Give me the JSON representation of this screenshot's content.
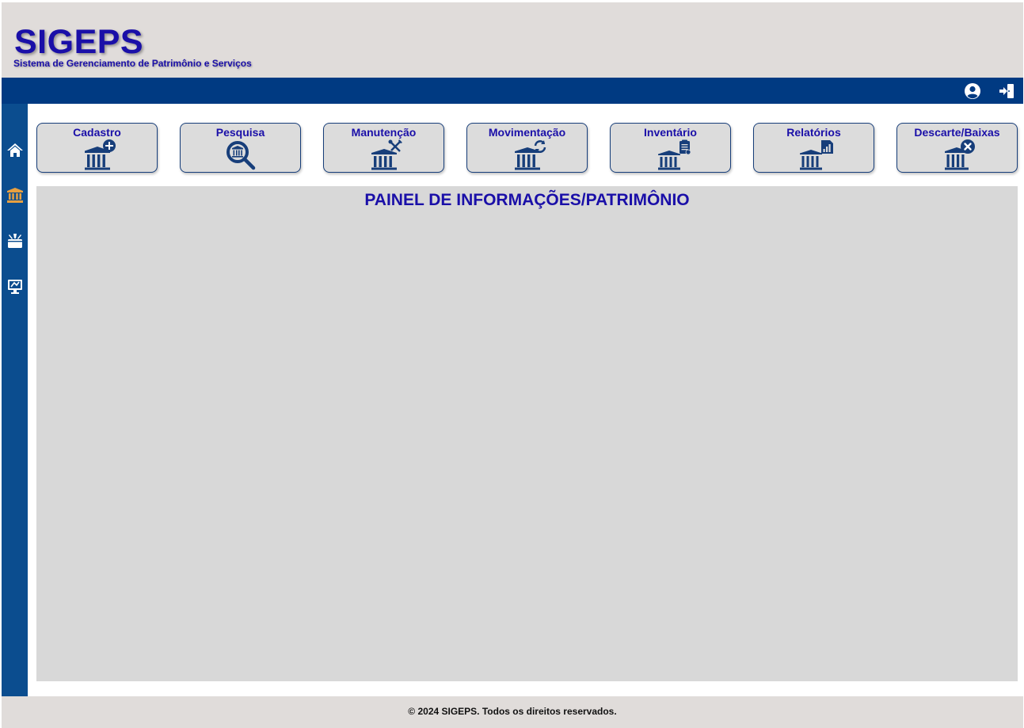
{
  "app": {
    "title": "SIGEPS",
    "subtitle": "Sistema de Gerenciamento de Patrimônio e Serviços"
  },
  "topbar": {
    "icons": [
      "user-circle-icon",
      "logout-icon"
    ]
  },
  "sidebar": {
    "items": [
      {
        "icon": "home-icon",
        "active": false
      },
      {
        "icon": "bank-icon",
        "active": true
      },
      {
        "icon": "toolbox-icon",
        "active": false
      },
      {
        "icon": "monitor-icon",
        "active": false
      }
    ]
  },
  "menu": {
    "items": [
      {
        "label": "Cadastro",
        "icon": "bank-add-icon"
      },
      {
        "label": "Pesquisa",
        "icon": "search-icon"
      },
      {
        "label": "Manutenção",
        "icon": "bank-tools-icon"
      },
      {
        "label": "Movimentação",
        "icon": "bank-sync-icon"
      },
      {
        "label": "Inventário",
        "icon": "bank-clipboard-icon"
      },
      {
        "label": "Relatórios",
        "icon": "bank-report-icon"
      },
      {
        "label": "Descarte/Baixas",
        "icon": "bank-remove-icon"
      }
    ]
  },
  "panel": {
    "title": "PAINEL DE INFORMAÇÕES/PATRIMÔNIO"
  },
  "footer": {
    "text": "© 2024 SIGEPS. Todos os direitos reservados."
  },
  "colors": {
    "primary": "#003a82",
    "sidebar": "#0b4d8f",
    "accent_text": "#1a0fa8",
    "active_icon": "#e8a040",
    "header_bg": "#e0dcda",
    "panel_bg": "#d8d8d8"
  }
}
